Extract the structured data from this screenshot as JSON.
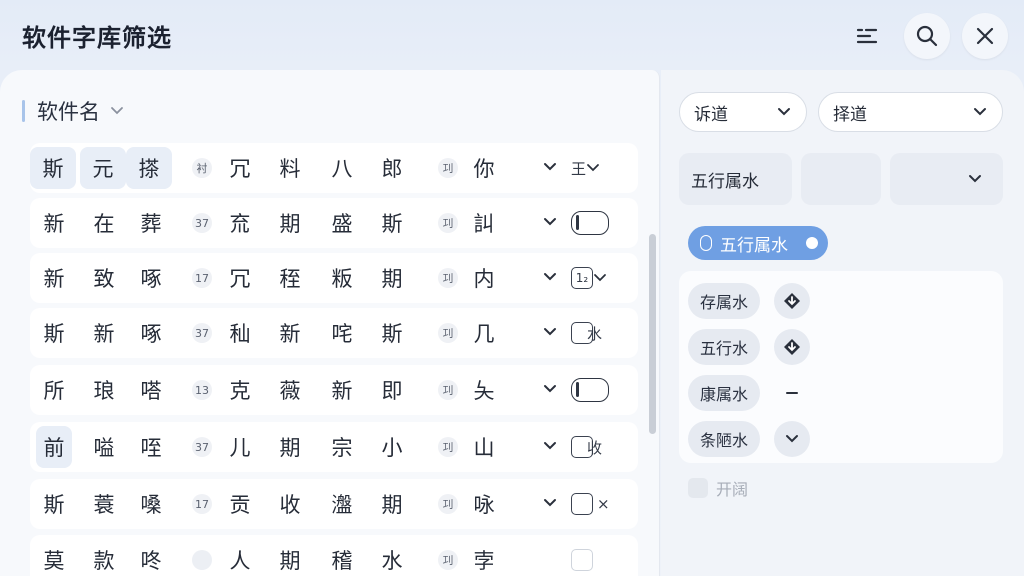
{
  "window": {
    "title": "软件字库筛选"
  },
  "section": {
    "label": "软件名"
  },
  "rows": [
    {
      "cells": [
        "斯",
        "元",
        "搽",
        "衬",
        "冗",
        "料",
        "八",
        "郎",
        "㓚",
        "你"
      ],
      "trail": "王"
    },
    {
      "cells": [
        "新",
        "在",
        "葬",
        "37",
        "㐬",
        "期",
        "盛",
        "斯",
        "㓚",
        "訆"
      ],
      "trail": ""
    },
    {
      "cells": [
        "新",
        "致",
        "啄",
        "17",
        "冗",
        "秷",
        "粄",
        "期",
        "㓚",
        "内"
      ],
      "trail": "1₂"
    },
    {
      "cells": [
        "斯",
        "新",
        "啄",
        "37",
        "秈",
        "新",
        "咤",
        "斯",
        "㓚",
        "几"
      ],
      "trail": "水"
    },
    {
      "cells": [
        "所",
        "琅",
        "嗒",
        "13",
        "克",
        "薇",
        "新",
        "即",
        "㓚",
        "夨"
      ],
      "trail": ""
    },
    {
      "cells": [
        "前",
        "嗌",
        "咥",
        "37",
        "儿",
        "期",
        "宗",
        "小",
        "㓚",
        "山"
      ],
      "trail": "收"
    },
    {
      "cells": [
        "斯",
        "蓑",
        "嗓",
        "17",
        "贡",
        "收",
        "瀊",
        "期",
        "㓚",
        "咏"
      ],
      "trail": "×"
    },
    {
      "cells": [
        "莫",
        "款",
        "咚",
        "",
        "人",
        "期",
        "稽",
        "水",
        "㓚",
        "孛"
      ],
      "trail": ""
    }
  ],
  "right": {
    "dropdown1": "诉道",
    "dropdown2": "择道",
    "tile1": "五行属水",
    "active_chip": "五行属水",
    "pills": [
      "存属水",
      "五行水",
      "康属水",
      "条陋水"
    ],
    "bottom_option": "开阔"
  }
}
